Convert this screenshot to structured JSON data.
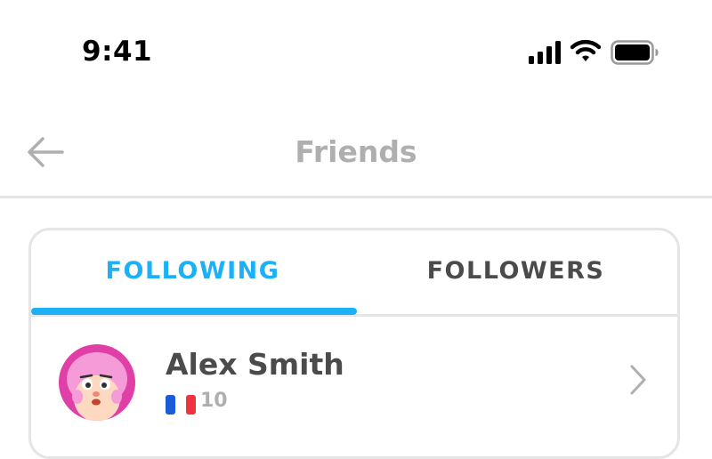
{
  "status_bar": {
    "time": "9:41",
    "icons": [
      "signal-icon",
      "wifi-icon",
      "battery-icon"
    ]
  },
  "header": {
    "title": "Friends",
    "back_icon": "arrow-left-icon"
  },
  "tabs": [
    {
      "label": "FOLLOWING",
      "active": true
    },
    {
      "label": "FOLLOWERS",
      "active": false
    }
  ],
  "friends": [
    {
      "name": "Alex Smith",
      "flag": "flag-icon",
      "score": "10"
    }
  ],
  "colors": {
    "accent": "#1cb0f6",
    "title": "#afafaf",
    "text": "#4b4b4b",
    "border": "#e5e5e5"
  }
}
